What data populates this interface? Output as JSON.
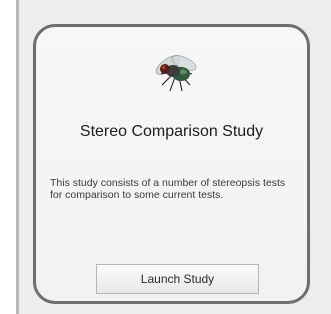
{
  "card": {
    "icon": "fly-icon",
    "title": "Stereo Comparison Study",
    "description": "This study consists of a number of stereopsis tests for comparison to some current tests.",
    "launch_label": "Launch Study"
  },
  "colors": {
    "background": "#ededed",
    "card_border": "#6e6e6e",
    "button_border": "#b5b5b5"
  }
}
